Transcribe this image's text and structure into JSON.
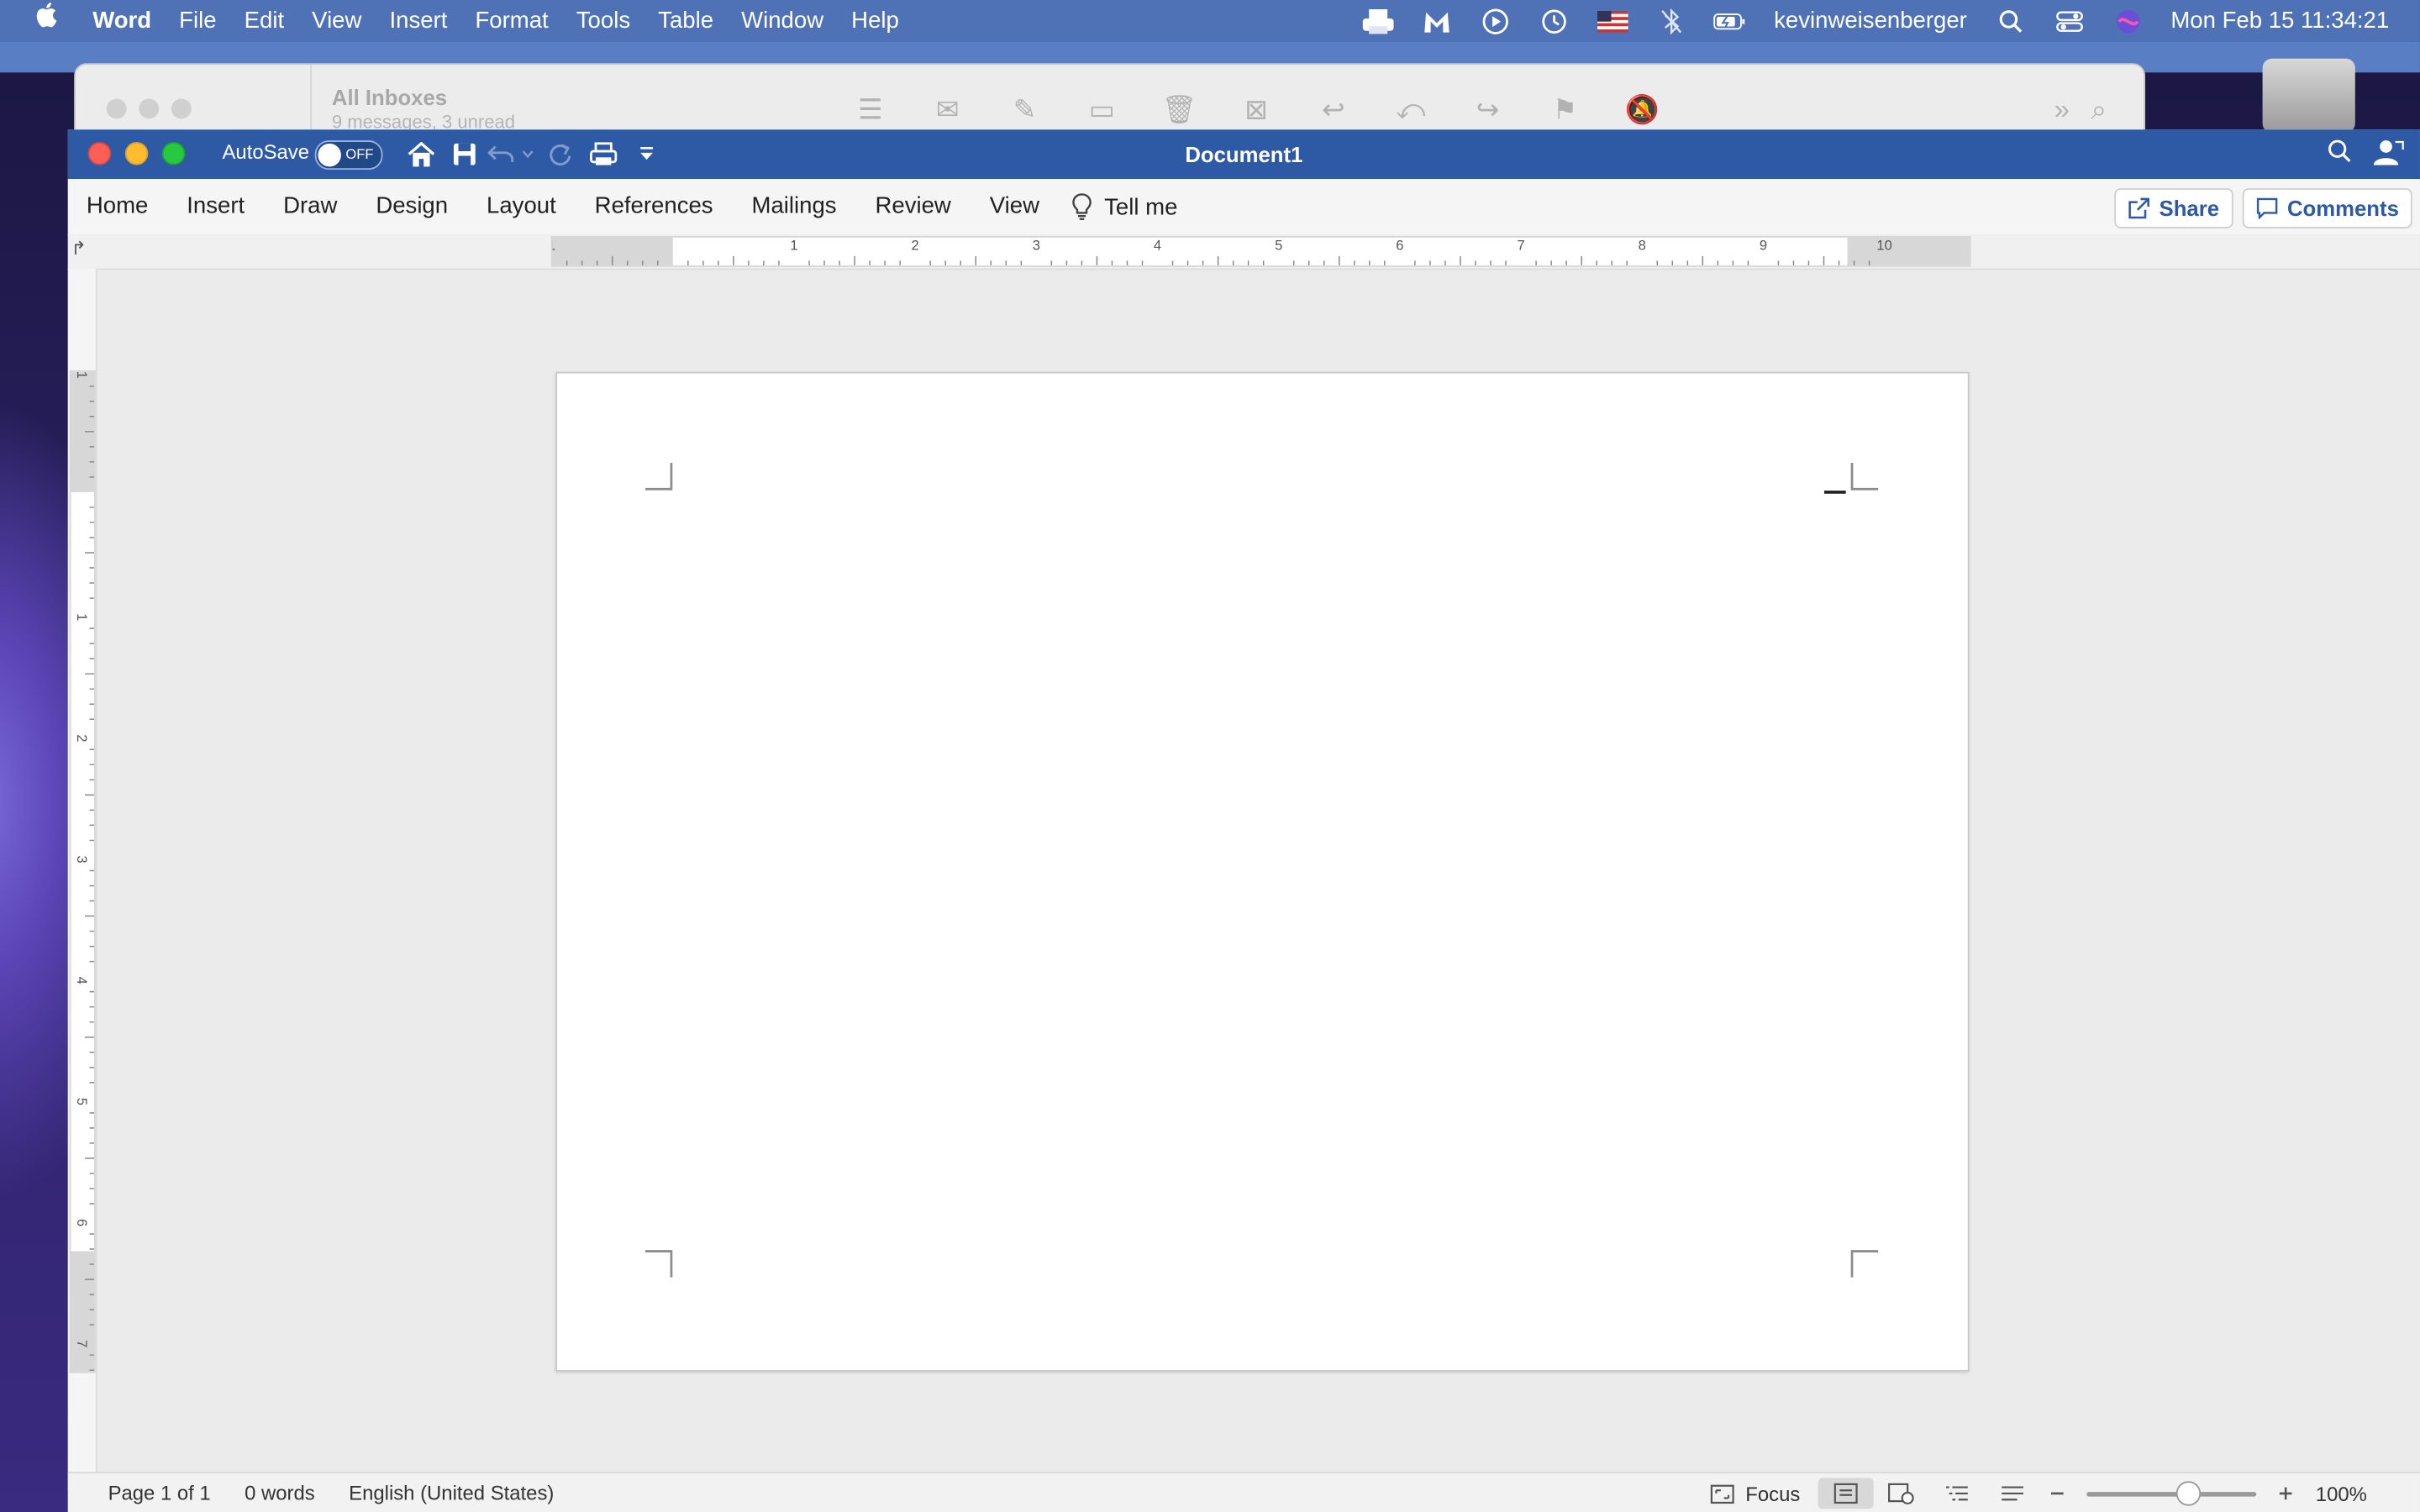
{
  "menubar": {
    "apple": "",
    "app_name": "Word",
    "items": [
      "File",
      "Edit",
      "View",
      "Insert",
      "Format",
      "Tools",
      "Table",
      "Window",
      "Help"
    ],
    "username": "kevinweisenberger",
    "datetime": "Mon Feb 15  11:34:21"
  },
  "mail_window": {
    "title": "All Inboxes",
    "subtitle": "9 messages, 3 unread"
  },
  "word": {
    "autosave_label": "AutoSave",
    "autosave_state": "OFF",
    "doc_title": "Document1",
    "tabs": [
      "Home",
      "Insert",
      "Draw",
      "Design",
      "Layout",
      "References",
      "Mailings",
      "Review",
      "View"
    ],
    "tell_me": "Tell me",
    "share": "Share",
    "comments": "Comments",
    "ruler_numbers": [
      "1",
      "1",
      "2",
      "3",
      "4",
      "5",
      "6",
      "7",
      "8",
      "9",
      "10"
    ],
    "vruler_numbers": [
      "1",
      "1",
      "2",
      "3",
      "4",
      "5",
      "6",
      "7"
    ]
  },
  "status": {
    "page": "Page 1 of 1",
    "words": "0 words",
    "language": "English (United States)",
    "focus": "Focus",
    "zoom": "100%",
    "zoom_level": 1.0
  },
  "colors": {
    "menubar": "#4f72b6",
    "titlebar": "#2e5aa5",
    "accent": "#2e5aa5"
  }
}
